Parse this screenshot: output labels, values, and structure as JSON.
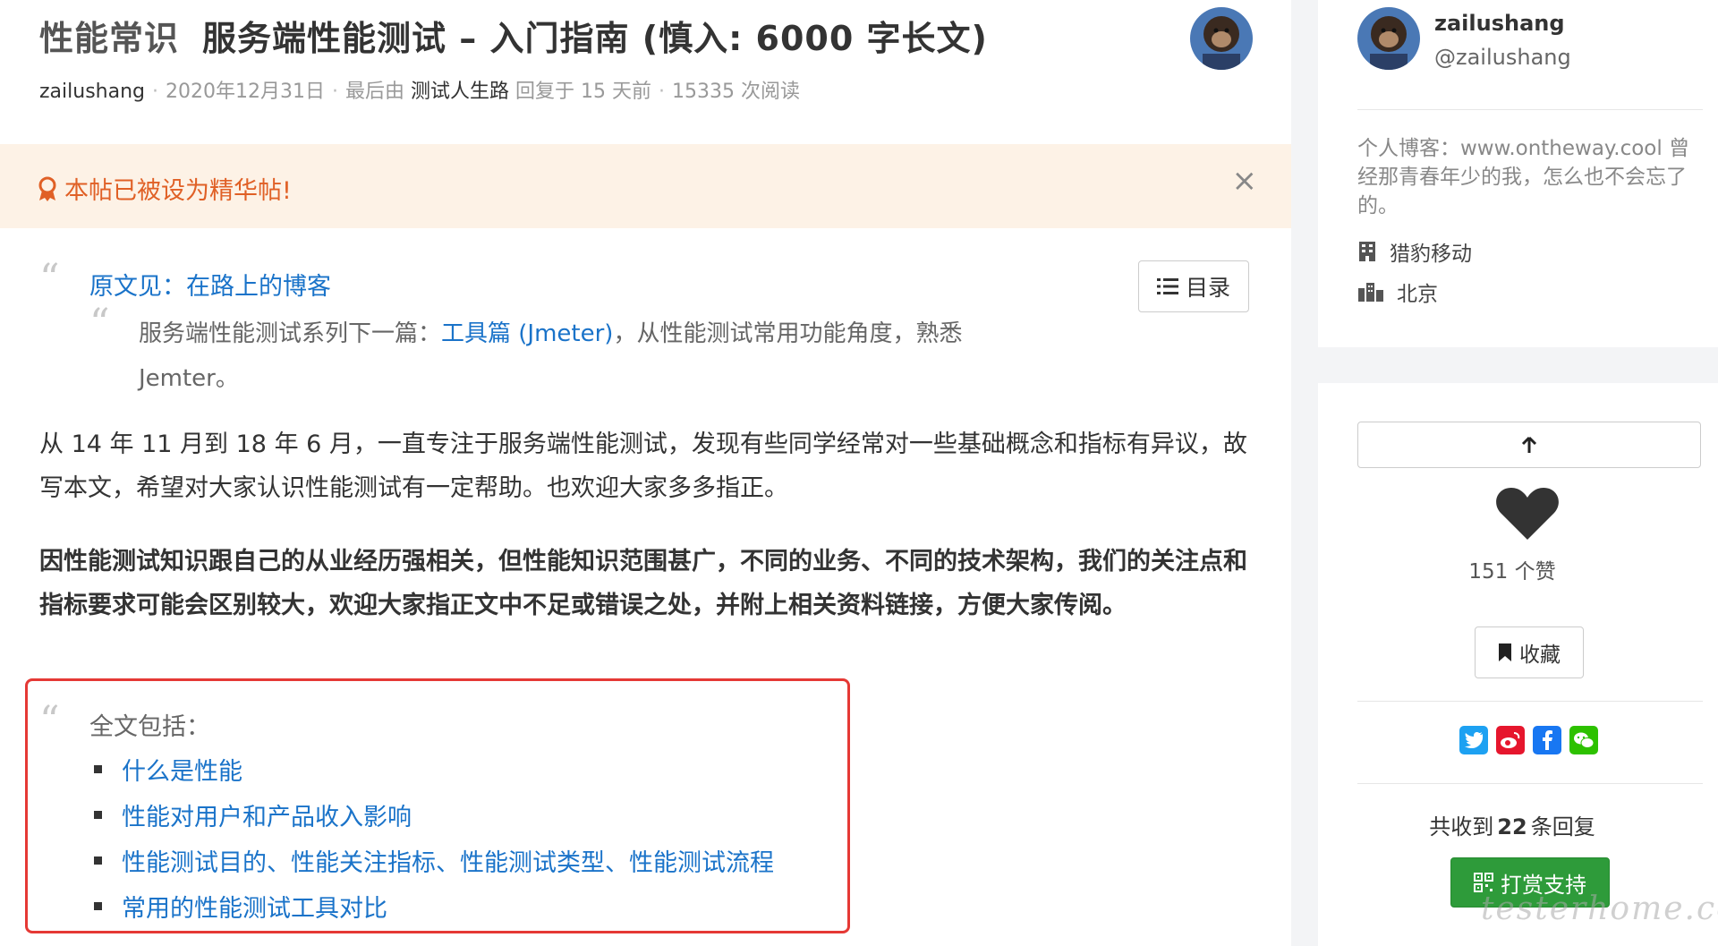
{
  "topic": {
    "category": "性能常识",
    "title": "服务端性能测试 – 入门指南 (慎入: 6000 字长文)",
    "author": "zailushang",
    "date": "2020年12月31日",
    "last_reply_prefix": "最后由",
    "last_reply_user": "测试人生路",
    "last_reply_suffix": "回复于 15 天前",
    "views": "15335 次阅读"
  },
  "banner": {
    "text": "本帖已被设为精华帖!",
    "close": "×"
  },
  "toc_button": "目录",
  "body": {
    "source_prefix": "原文见：",
    "source_link": "在路上的博客",
    "series_prefix": "服务端性能测试系列下一篇：",
    "series_link": "工具篇 (Jmeter)",
    "series_suffix": "，从性能测试常用功能角度，熟悉 Jemter。",
    "para1": "从 14 年 11 月到 18 年 6 月，一直专注于服务端性能测试，发现有些同学经常对一些基础概念和指标有异议，故写本文，希望对大家认识性能测试有一定帮助。也欢迎大家多多指正。",
    "para2": "因性能测试知识跟自己的从业经历强相关，但性能知识范围甚广，不同的业务、不同的技术架构，我们的关注点和指标要求可能会区别较大，欢迎大家指正文中不足或错误之处，并附上相关资料链接，方便大家传阅。",
    "contents_head": "全文包括：",
    "contents": [
      "什么是性能",
      "性能对用户和产品收入影响",
      "性能测试目的、性能关注指标、性能测试类型、性能测试流程",
      "常用的性能测试工具对比"
    ]
  },
  "sidebar": {
    "name": "zailushang",
    "handle": "@zailushang",
    "bio": "个人博客：www.ontheway.cool 曾经那青春年少的我，怎么也不会忘了的。",
    "company": "猎豹移动",
    "city": "北京",
    "likes": "151 个赞",
    "favorite": "收藏",
    "replies_prefix": "共收到",
    "replies_count": "22",
    "replies_suffix": "条回复",
    "tip": "打赏支持",
    "share": [
      "twitter",
      "weibo",
      "facebook",
      "wechat"
    ]
  },
  "watermark": "testerhome.com",
  "colors": {
    "link": "#1a73c9",
    "banner_bg": "#fdf2e6",
    "banner_text": "#e06026",
    "highlight_border": "#e53935",
    "tip_green": "#2e9b3a",
    "twitter": "#1da1f2",
    "weibo": "#e6162d",
    "facebook": "#1877f2",
    "wechat": "#2dc100"
  }
}
